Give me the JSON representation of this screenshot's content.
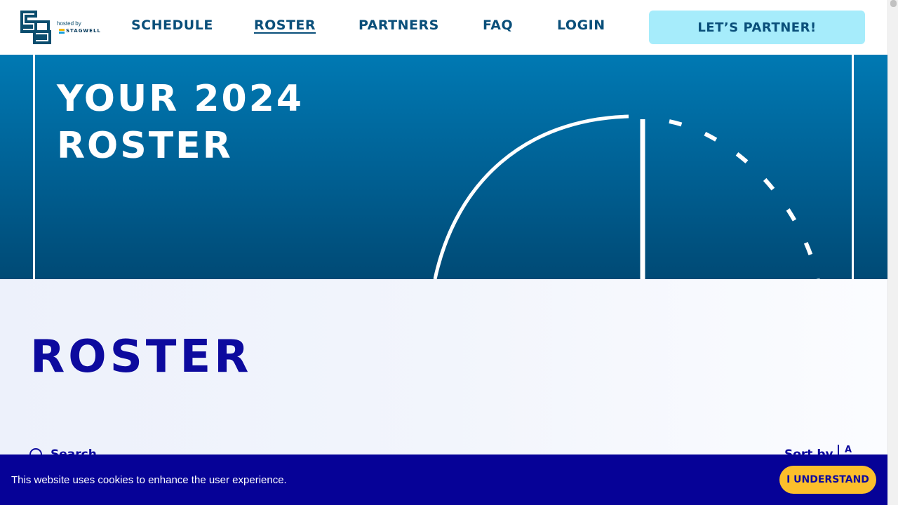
{
  "header": {
    "logo": {
      "hosted_text": "hosted by",
      "partner_name": "STAGWELL"
    },
    "nav": [
      {
        "label": "SCHEDULE"
      },
      {
        "label": "ROSTER"
      },
      {
        "label": "PARTNERS"
      },
      {
        "label": "FAQ"
      },
      {
        "label": "LOGIN"
      }
    ],
    "cta_label": "LET’S PARTNER!"
  },
  "hero": {
    "title_line1": "YOUR 2024",
    "title_line2": "ROSTER"
  },
  "roster": {
    "title": "ROSTER",
    "search_label": "Search",
    "sort_label": "Sort by",
    "sort_value": "A"
  },
  "cookie": {
    "message": "This website uses cookies to enhance the user experience.",
    "button_label": "I UNDERSTAND"
  },
  "colors": {
    "brand_navy": "#0a4f7a",
    "roster_blue": "#0d0a9e",
    "cta_bg": "#a6ecfb",
    "cookie_bg": "#060297",
    "cookie_button": "#fcbf2b"
  }
}
